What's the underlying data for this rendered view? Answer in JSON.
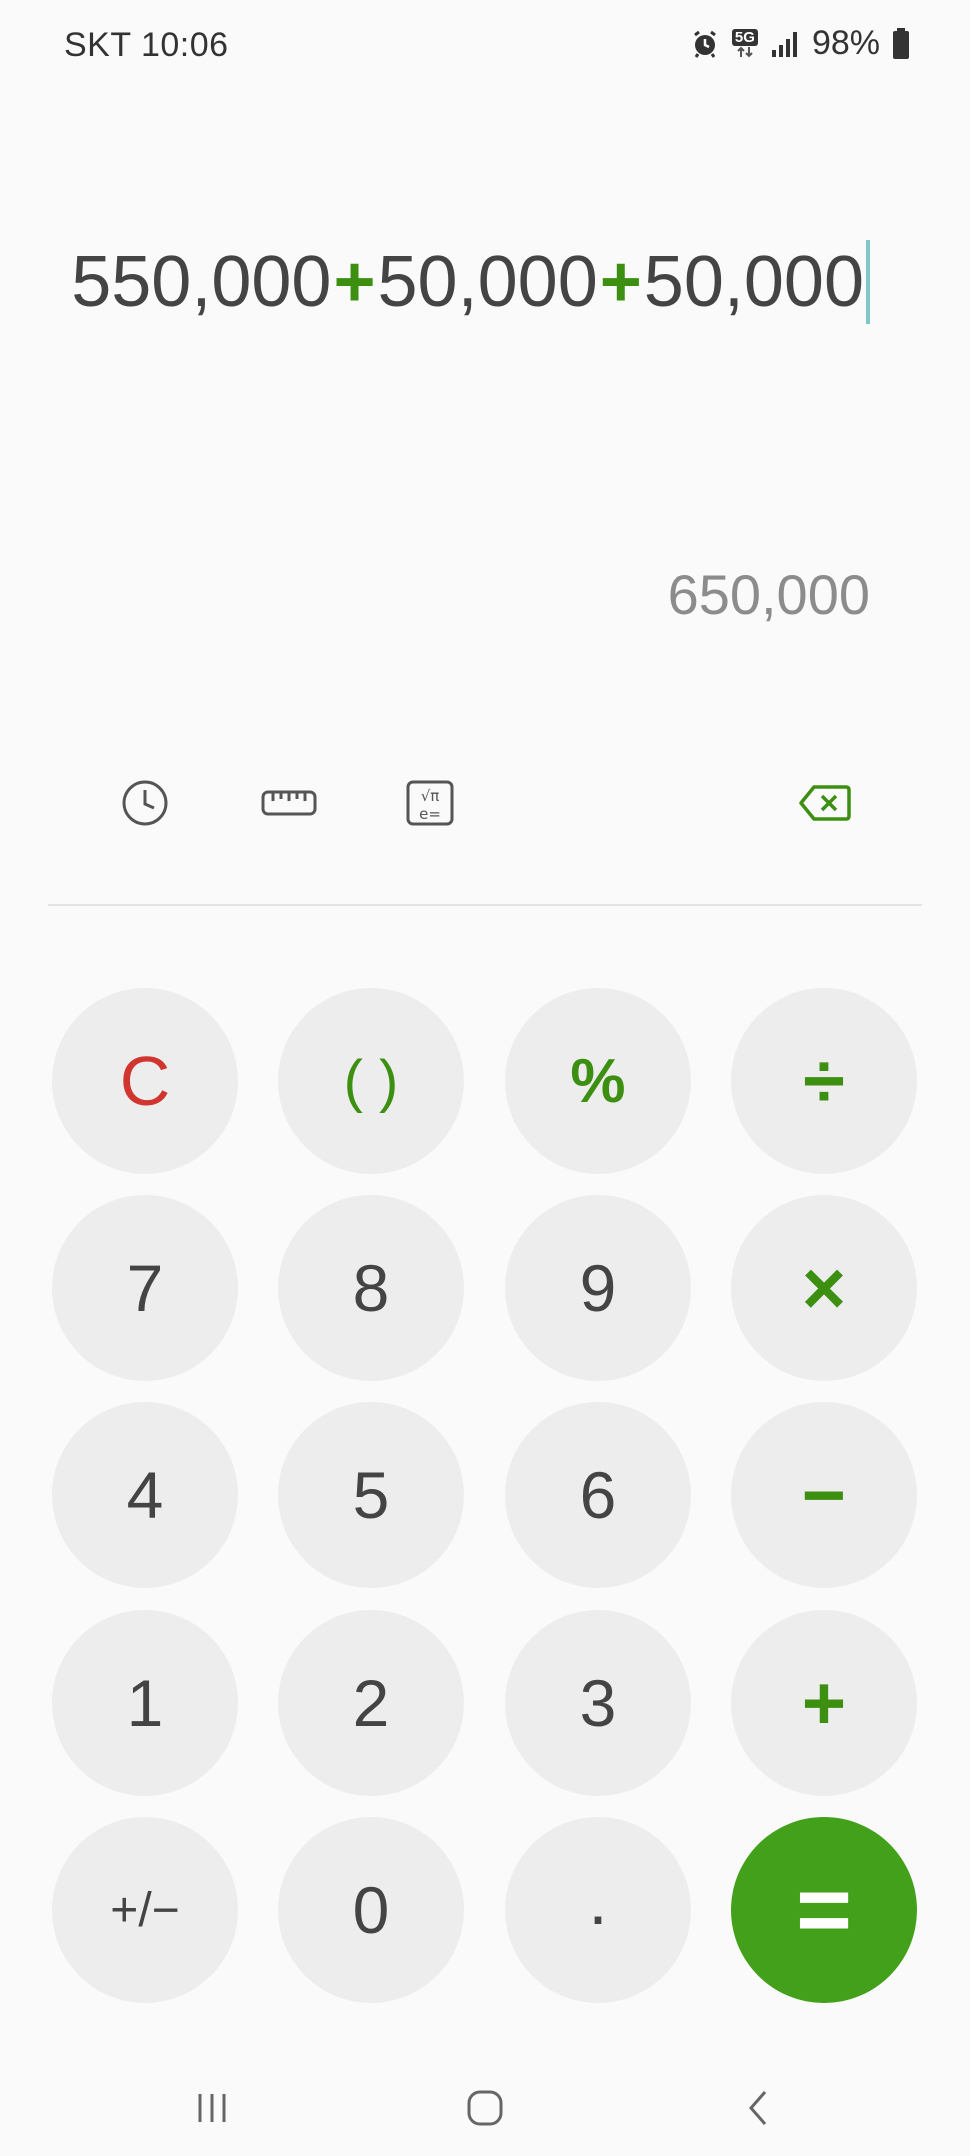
{
  "status_bar": {
    "carrier_time": "SKT 10:06",
    "network": "5G",
    "battery": "98%",
    "icons": [
      "alarm-icon",
      "5g-icon",
      "signal-icon",
      "battery-icon"
    ]
  },
  "display": {
    "expression_parts": [
      {
        "text": "550,000",
        "kind": "number"
      },
      {
        "text": "+",
        "kind": "operator"
      },
      {
        "text": "50,000",
        "kind": "number"
      },
      {
        "text": "+",
        "kind": "operator"
      },
      {
        "text": "50,000",
        "kind": "number"
      }
    ],
    "result": "650,000"
  },
  "toolbar": {
    "icons": [
      "history-icon",
      "ruler-icon",
      "scientific-icon",
      "backspace-icon"
    ]
  },
  "keypad": {
    "rows": [
      [
        "C",
        "( )",
        "%",
        "÷"
      ],
      [
        "7",
        "8",
        "9",
        "×"
      ],
      [
        "4",
        "5",
        "6",
        "−"
      ],
      [
        "1",
        "2",
        "3",
        "+"
      ],
      [
        "+/−",
        "0",
        ".",
        "="
      ]
    ]
  },
  "navbar": {
    "icons": [
      "recent-apps-icon",
      "home-icon",
      "back-icon"
    ]
  },
  "colors": {
    "accent": "#3d8f12",
    "equals_bg": "#43a01b",
    "clear": "#d0362f",
    "key_bg": "#ededed",
    "result_text": "#8c8c8c"
  }
}
